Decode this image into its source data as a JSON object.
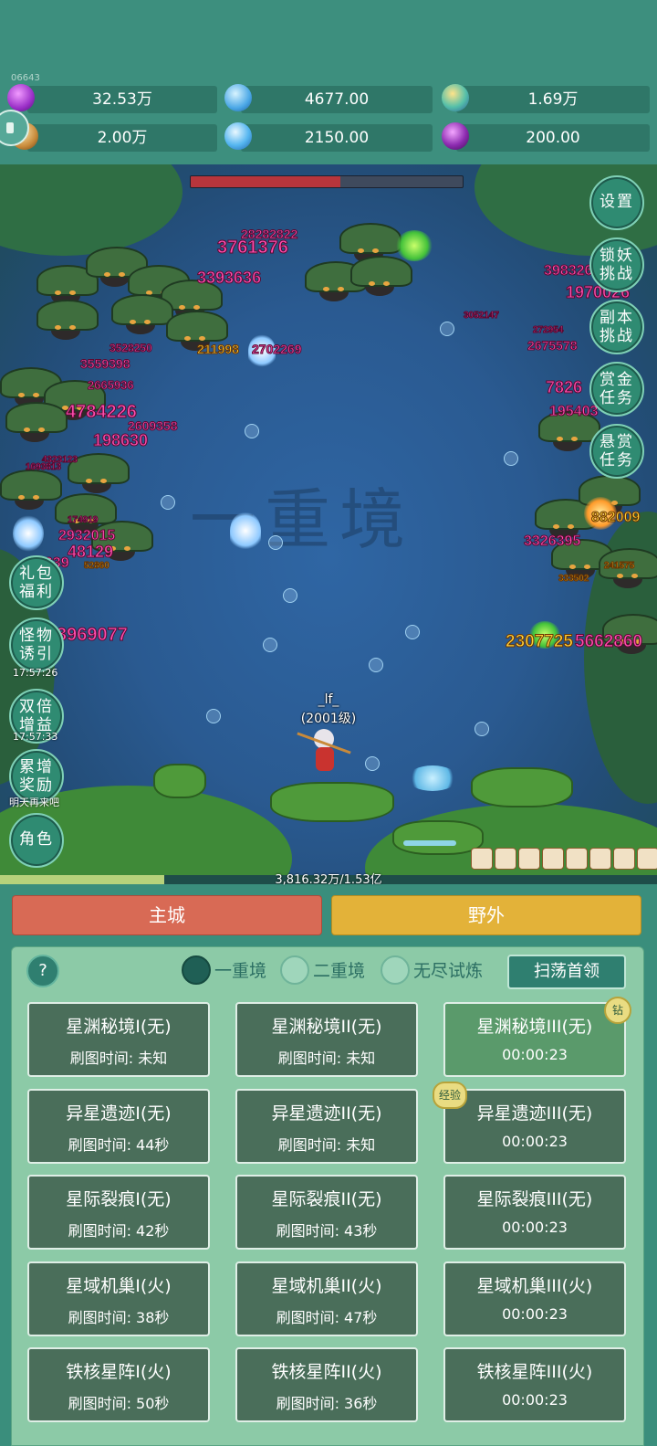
{
  "header": {
    "id_text": "06643",
    "resources_row1": [
      {
        "icon": "purple-gem-icon",
        "value": "32.53万"
      },
      {
        "icon": "blue-crystal-icon",
        "value": "4677.00"
      },
      {
        "icon": "rainbow-orb-icon",
        "value": "1.69万"
      }
    ],
    "resources_row2": [
      {
        "icon": "gold-scroll-icon",
        "value": "2.00万"
      },
      {
        "icon": "ice-shard-icon",
        "value": "2150.00"
      },
      {
        "icon": "purple-fruit-icon",
        "value": "200.00"
      }
    ]
  },
  "scene": {
    "watermark": "一重境",
    "boss_hp_fraction": 0.55,
    "damage_numbers": [
      "3761376",
      "28282822",
      "3393636",
      "3983264",
      "1970026",
      "3052147",
      "272954",
      "2675578",
      "7826",
      "195403",
      "3528250",
      "3559398",
      "211998",
      "2702269",
      "2665936",
      "4784226",
      "2609358",
      "198630",
      "4323123",
      "1693813",
      "174919",
      "2932015",
      "48129",
      "4639",
      "52860",
      "3969077",
      "882009",
      "3326395",
      "241575",
      "333502",
      "2307725",
      "5662860"
    ],
    "player_name": "_lf_",
    "player_level": "(2001级)"
  },
  "right_buttons": [
    {
      "label": "设置"
    },
    {
      "label": "锁妖挑战"
    },
    {
      "label": "副本挑战"
    },
    {
      "label": "赏金任务"
    },
    {
      "label": "悬赏任务"
    }
  ],
  "left_buttons": [
    {
      "label": "礼包福利",
      "time": ""
    },
    {
      "label": "怪物诱引",
      "time": "17:57:26"
    },
    {
      "label": "双倍增益",
      "time": "17:57:33"
    },
    {
      "label": "累增奖励",
      "time": "明天再来吧"
    },
    {
      "label": "角色",
      "time": ""
    }
  ],
  "exp": {
    "text": "3,816.32万/1.53亿",
    "fraction": 0.25
  },
  "tabs": {
    "city": "主城",
    "wild": "野外"
  },
  "panel": {
    "help": "?",
    "realms": [
      {
        "label": "一重境",
        "selected": true
      },
      {
        "label": "二重境",
        "selected": false
      },
      {
        "label": "无尽试炼",
        "selected": false
      }
    ],
    "sweep_button": "扫荡首领",
    "cards": [
      {
        "title": "星渊秘境I(无)",
        "sub": "刷图时间: 未知",
        "badge": ""
      },
      {
        "title": "星渊秘境II(无)",
        "sub": "刷图时间: 未知",
        "badge": ""
      },
      {
        "title": "星渊秘境III(无)",
        "sub": "00:00:23",
        "badge": "钻"
      },
      {
        "title": "异星遗迹I(无)",
        "sub": "刷图时间: 44秒",
        "badge": ""
      },
      {
        "title": "异星遗迹II(无)",
        "sub": "刷图时间: 未知",
        "badge": ""
      },
      {
        "title": "异星遗迹III(无)",
        "sub": "00:00:23",
        "badge": "经验"
      },
      {
        "title": "星际裂痕I(无)",
        "sub": "刷图时间: 42秒",
        "badge": ""
      },
      {
        "title": "星际裂痕II(无)",
        "sub": "刷图时间: 43秒",
        "badge": ""
      },
      {
        "title": "星际裂痕III(无)",
        "sub": "00:00:23",
        "badge": ""
      },
      {
        "title": "星域机巢I(火)",
        "sub": "刷图时间: 38秒",
        "badge": ""
      },
      {
        "title": "星域机巢II(火)",
        "sub": "刷图时间: 47秒",
        "badge": ""
      },
      {
        "title": "星域机巢III(火)",
        "sub": "00:00:23",
        "badge": ""
      },
      {
        "title": "铁核星阵I(火)",
        "sub": "刷图时间: 50秒",
        "badge": ""
      },
      {
        "title": "铁核星阵II(火)",
        "sub": "刷图时间: 36秒",
        "badge": ""
      },
      {
        "title": "铁核星阵III(火)",
        "sub": "00:00:23",
        "badge": ""
      }
    ]
  }
}
